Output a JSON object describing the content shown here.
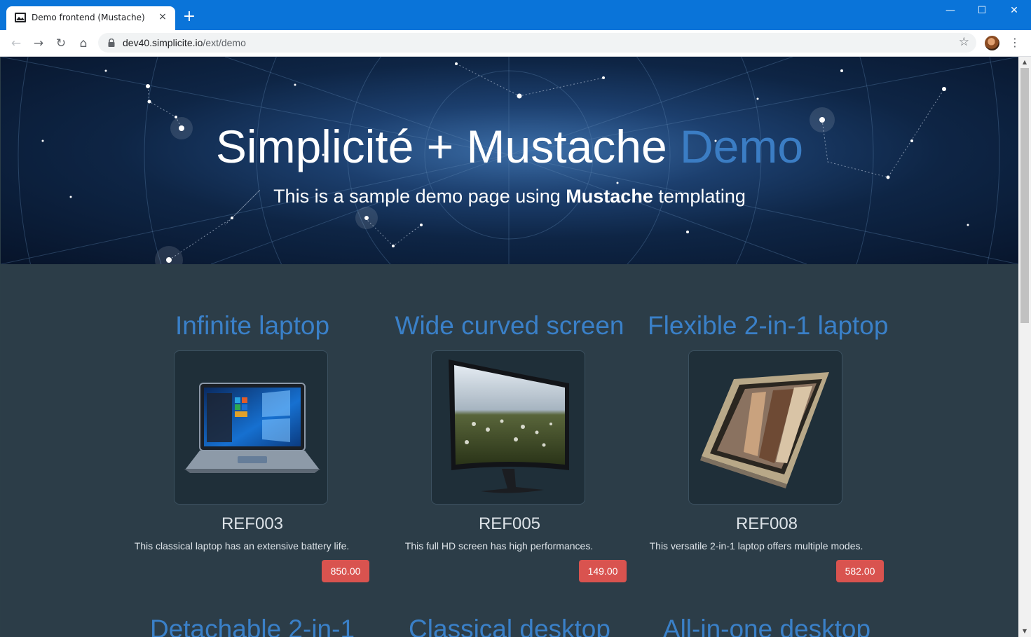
{
  "browser": {
    "tab_title": "Demo frontend (Mustache)",
    "tab_close": "×",
    "new_tab": "+",
    "url_host": "dev40.simplicite.io",
    "url_path": "/ext/demo",
    "window_minimize": "—",
    "window_maximize": "☐",
    "window_close": "✕",
    "back": "←",
    "forward": "→",
    "reload": "↻",
    "home": "⌂",
    "bookmark": "☆",
    "menu": "⋮"
  },
  "hero": {
    "title_main": "Simplicité + Mustache ",
    "title_accent": "Demo",
    "subtitle_prefix": "This is a sample demo page using ",
    "subtitle_bold": "Mustache",
    "subtitle_suffix": " templating",
    "accent_color": "#3b7dc4"
  },
  "products": [
    {
      "name": "Infinite laptop",
      "ref": "REF003",
      "description": "This classical laptop has an extensive battery life.",
      "price": "850.00",
      "image": "laptop"
    },
    {
      "name": "Wide curved screen",
      "ref": "REF005",
      "description": "This full HD screen has high performances.",
      "price": "149.00",
      "image": "curved-monitor"
    },
    {
      "name": "Flexible 2-in-1 laptop",
      "ref": "REF008",
      "description": "This versatile 2-in-1 laptop offers multiple modes.",
      "price": "582.00",
      "image": "convertible-laptop"
    }
  ],
  "products_next_row": [
    {
      "name": "Detachable 2-in-1"
    },
    {
      "name": "Classical desktop"
    },
    {
      "name": "All-in-one desktop"
    }
  ],
  "colors": {
    "price_badge": "#d9534f",
    "product_title": "#3a80c8",
    "page_background": "#2c3d48",
    "titlebar": "#0a74d9"
  },
  "scrollbar": {
    "up": "▲",
    "down": "▼"
  }
}
